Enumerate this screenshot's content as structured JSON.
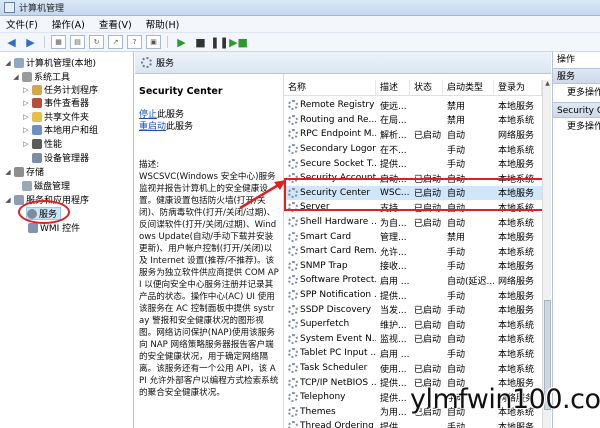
{
  "window": {
    "title": "计算机管理"
  },
  "menu": [
    "文件(F)",
    "操作(A)",
    "查看(V)",
    "帮助(H)"
  ],
  "tree": [
    {
      "label": "计算机管理(本地)",
      "level": 0,
      "expanded": true
    },
    {
      "label": "系统工具",
      "level": 1,
      "expanded": true
    },
    {
      "label": "任务计划程序",
      "level": 2
    },
    {
      "label": "事件查看器",
      "level": 2
    },
    {
      "label": "共享文件夹",
      "level": 2
    },
    {
      "label": "本地用户和组",
      "level": 2
    },
    {
      "label": "性能",
      "level": 2
    },
    {
      "label": "设备管理器",
      "level": 2
    },
    {
      "label": "存储",
      "level": 1,
      "expanded": true
    },
    {
      "label": "磁盘管理",
      "level": 2
    },
    {
      "label": "服务和应用程序",
      "level": 1,
      "expanded": true
    },
    {
      "label": "服务",
      "level": 2,
      "selected": true
    },
    {
      "label": "WMI 控件",
      "level": 2
    }
  ],
  "middle": {
    "header": "服务",
    "service_name": "Security Center",
    "stop_link": "停止",
    "stop_suffix": "此服务",
    "restart_link": "重启动",
    "restart_suffix": "此服务",
    "description": "描述:\nWSCSVC(Windows 安全中心)服务监视并报告计算机上的安全健康设置。健康设置包括防火墙(打开/关闭)、防病毒软件(打开/关闭/过期)、反间谍软件(打开/关闭/过期)、Windows Update(自动/手动下载并安装更新)、用户帐户控制(打开/关闭)以及 Internet 设置(推荐/不推荐)。该服务为独立软件供应商提供 COM API 以便向安全中心服务注册并记录其产品的状态。操作中心(AC) UI 使用该服务在 AC 控制面板中提供 systray 警报和安全健康状况的图形视图。网络访问保护(NAP)使用该服务向 NAP 网络策略服务器报告客户端的安全健康状况，用于确定网络隔离。该服务还有一个公用 API，该 API 允许外部客户以编程方式检索系统的聚合安全健康状况。"
  },
  "columns": [
    "名称",
    "描述",
    "状态",
    "启动类型",
    "登录为"
  ],
  "rows": [
    [
      "Remote Registry",
      "使远...",
      "",
      "禁用",
      "本地服务"
    ],
    [
      "Routing and Re...",
      "在局...",
      "",
      "禁用",
      "本地系统"
    ],
    [
      "RPC Endpoint M...",
      "解析...",
      "已启动",
      "自动",
      "网络服务"
    ],
    [
      "Secondary Logon",
      "在不...",
      "",
      "手动",
      "本地系统"
    ],
    [
      "Secure Socket T...",
      "提供...",
      "",
      "手动",
      "本地服务"
    ],
    [
      "Security Account...",
      "启动...",
      "已启动",
      "自动",
      "本地系统"
    ],
    [
      "Security Center",
      "WSC...",
      "已启动",
      "自动",
      "本地服务"
    ],
    [
      "Server",
      "支持...",
      "已启动",
      "自动",
      "本地系统"
    ],
    [
      "Shell Hardware ...",
      "为自...",
      "已启动",
      "自动",
      "本地系统"
    ],
    [
      "Smart Card",
      "管理...",
      "",
      "禁用",
      "本地服务"
    ],
    [
      "Smart Card Rem...",
      "允许...",
      "",
      "手动",
      "本地系统"
    ],
    [
      "SNMP Trap",
      "接收...",
      "",
      "手动",
      "本地服务"
    ],
    [
      "Software Protect...",
      "启用 ...",
      "",
      "自动(延迟...",
      "网络服务"
    ],
    [
      "SPP Notification ...",
      "提供...",
      "",
      "手动",
      "本地服务"
    ],
    [
      "SSDP Discovery",
      "当发...",
      "已启动",
      "手动",
      "本地服务"
    ],
    [
      "Superfetch",
      "维护...",
      "已启动",
      "自动",
      "本地系统"
    ],
    [
      "System Event N...",
      "监视...",
      "已启动",
      "自动",
      "本地系统"
    ],
    [
      "Tablet PC Input ...",
      "启用 ...",
      "",
      "手动",
      "本地系统"
    ],
    [
      "Task Scheduler",
      "使用...",
      "已启动",
      "自动",
      "本地系统"
    ],
    [
      "TCP/IP NetBIOS ...",
      "提供...",
      "已启动",
      "自动",
      "本地服务"
    ],
    [
      "Telephony",
      "提供...",
      "",
      "手动",
      "网络服务"
    ],
    [
      "Themes",
      "为用...",
      "已启动",
      "自动",
      "本地系统"
    ],
    [
      "Thread Ordering ...",
      "提供...",
      "",
      "手动",
      "本地服务"
    ]
  ],
  "selected_row": 6,
  "actions": {
    "header": "操作",
    "section1": "服务",
    "item1": "更多操作",
    "section2": "Security Center",
    "item2": "更多操作"
  },
  "watermark": "ylmfwin100.com",
  "colors": {
    "highlight": "#e02020",
    "selection": "#cfe6fb",
    "link": "#1a4fc4"
  }
}
